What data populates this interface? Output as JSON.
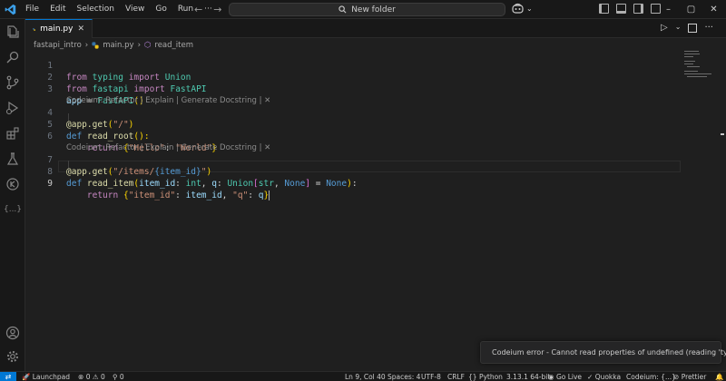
{
  "menu": [
    "File",
    "Edit",
    "Selection",
    "View",
    "Go",
    "Run",
    "···"
  ],
  "search": {
    "label": "New folder"
  },
  "window": {
    "minimize": "–",
    "maximize": "▢",
    "close": "✕"
  },
  "tab": {
    "label": "main.py",
    "close": "✕"
  },
  "breadcrumb": {
    "folder": "fastapi_intro",
    "file": "main.py",
    "symbol": "read_item"
  },
  "code": {
    "line_numbers": [
      "1",
      "2",
      "3",
      "4",
      "5",
      "6",
      "7",
      "8",
      "9"
    ],
    "lens_label": "Codeium: Refactor | Explain | Generate Docstring | ✕",
    "l1": {
      "from": "from",
      "mod": "typing",
      "import": "import",
      "name": "Union"
    },
    "l2": {
      "from": "from",
      "mod": "fastapi",
      "import": "import",
      "name": "FastAPI"
    },
    "l3": {
      "var": "app",
      "eq": " = ",
      "cls": "FastAPI",
      "args": "()"
    },
    "l4": {
      "deco": "@app.get",
      "arg": "\"/\""
    },
    "l5": {
      "def": "def",
      "fn": "read_root",
      "rest": "():"
    },
    "l6": {
      "ret": "return",
      "k": "\"Hello\"",
      "colon": ": ",
      "v": "\"World\""
    },
    "l7": {
      "deco": "@app.get",
      "arg1": "\"/items/",
      "brace": "{item_id}",
      "arg2": "\""
    },
    "l8": {
      "def": "def",
      "fn": "read_item",
      "p1": "item_id",
      "t1": "int",
      "p2": "q",
      "t2": "Union",
      "t3": "str",
      "t4": "None",
      "t5": "None"
    },
    "l9": {
      "ret": "return",
      "k1": "\"item_id\"",
      "v1": "item_id",
      "k2": "\"q\"",
      "v2": "q"
    }
  },
  "notification": {
    "text": "Codeium error - Cannot read properties of undefined (reading 'type')"
  },
  "status": {
    "launchpad": "Launchpad",
    "problems_errors": "0",
    "problems_warnings": "0",
    "ports": "0",
    "position": "Ln 9, Col 40",
    "spaces": "Spaces: 4",
    "encoding": "UTF-8",
    "eol": "CRLF",
    "language": "Python",
    "interpreter": "3.13.1 64-bit",
    "golive": "Go Live",
    "quokka": "Quokka",
    "codeium": "Codeium: {...}",
    "prettier": "Prettier"
  },
  "colors": {
    "accent": "#0078d4",
    "error": "#f14c4c"
  }
}
